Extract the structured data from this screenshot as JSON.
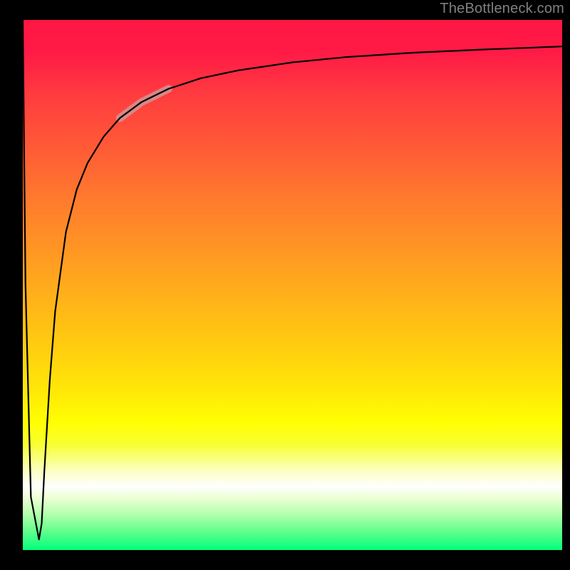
{
  "watermark": "TheBottleneck.com",
  "colors": {
    "background": "#000000",
    "gradient_top": "#ff1744",
    "gradient_bottom": "#00ff7a",
    "watermark": "#808080",
    "curve": "#000000",
    "highlight": "#c9a0a0"
  },
  "chart_data": {
    "type": "line",
    "title": "",
    "xlabel": "",
    "ylabel": "",
    "xlim": [
      0,
      100
    ],
    "ylim": [
      0,
      100
    ],
    "grid": false,
    "legend": false,
    "annotations": [
      "TheBottleneck.com"
    ],
    "series": [
      {
        "name": "curve",
        "x": [
          0,
          0.5,
          1.5,
          3,
          3.5,
          4,
          5,
          6,
          8,
          10,
          12,
          15,
          18,
          22,
          27,
          33,
          40,
          50,
          60,
          72,
          85,
          100
        ],
        "y": [
          100,
          50,
          10,
          2,
          5,
          15,
          32,
          45,
          60,
          68,
          73,
          78,
          81.5,
          84.5,
          87,
          89,
          90.5,
          92,
          93,
          93.8,
          94.4,
          95
        ],
        "highlight_segment": {
          "x_start": 18,
          "x_end": 27
        }
      }
    ]
  }
}
